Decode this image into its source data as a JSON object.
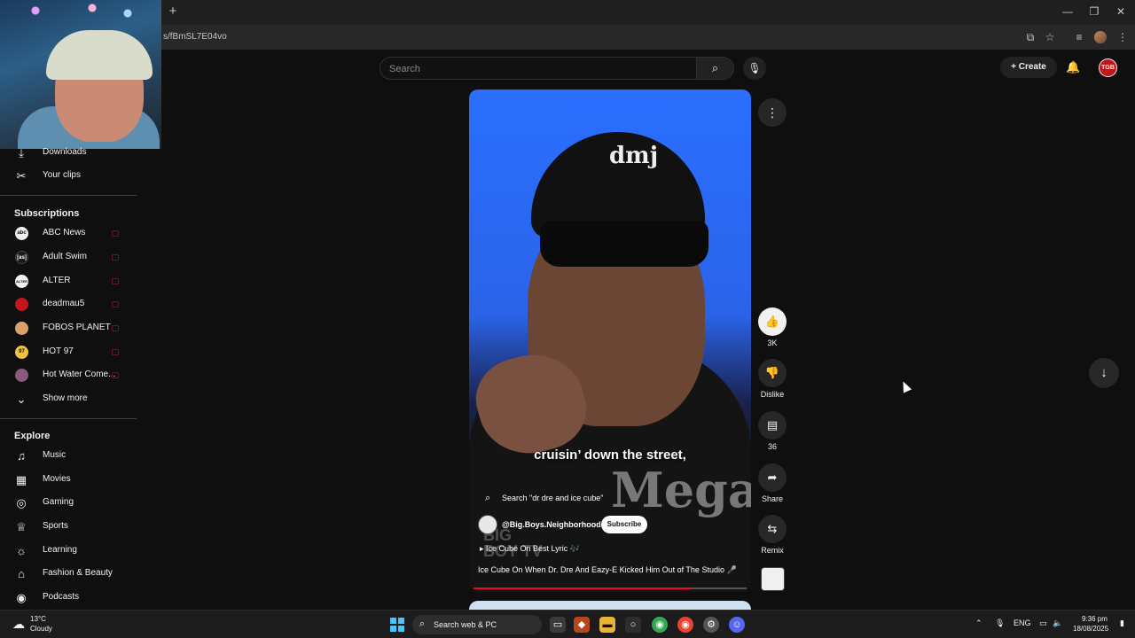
{
  "browser": {
    "url": "s/fBmSL7E04vo",
    "new_tab_icon": "+",
    "minimize_icon": "—",
    "restore_icon": "❐",
    "close_icon": "✕"
  },
  "header": {
    "search_placeholder": "Search",
    "create_label": "Create",
    "avatar_text": "TGB"
  },
  "sidebar": {
    "top_items": [
      {
        "label": "Downloads",
        "icon": "download-icon"
      },
      {
        "label": "Your clips",
        "icon": "scissors-icon"
      }
    ],
    "subscriptions_title": "Subscriptions",
    "subscriptions": [
      {
        "label": "ABC News",
        "color": "#f1f1f1",
        "text": "abc"
      },
      {
        "label": "Adult Swim",
        "color": "#1a1a1a",
        "text": "[as]"
      },
      {
        "label": "ALTER",
        "color": "#f1f1f1",
        "text": "ALTER"
      },
      {
        "label": "deadmau5",
        "color": "#c4151c",
        "text": ""
      },
      {
        "label": "FOBOS PLANET",
        "color": "#d9a26a",
        "text": ""
      },
      {
        "label": "HOT 97",
        "color": "#f0c040",
        "text": "97"
      },
      {
        "label": "Hot Water Come...",
        "color": "#8a5a7a",
        "text": ""
      }
    ],
    "show_more": "Show more",
    "explore_title": "Explore",
    "explore": [
      {
        "label": "Music",
        "icon": "music-note-icon"
      },
      {
        "label": "Movies",
        "icon": "film-icon"
      },
      {
        "label": "Gaming",
        "icon": "gamepad-icon"
      },
      {
        "label": "Sports",
        "icon": "trophy-icon"
      },
      {
        "label": "Learning",
        "icon": "lightbulb-icon"
      },
      {
        "label": "Fashion & Beauty",
        "icon": "hanger-icon"
      },
      {
        "label": "Podcasts",
        "icon": "podcast-icon"
      }
    ]
  },
  "video": {
    "cap_logo": "dmj",
    "caption": "cruisin’ down the street,",
    "watermark": "Mega",
    "brand": "BIG\nBOY TV",
    "search_label": "Search \"dr dre and ice cube\"",
    "channel": "@Big.Boys.Neighborhood",
    "subscribe_label": "Subscribe",
    "sound_label": "▸  Ice Cube On Best Lyric 🎶",
    "title": "Ice Cube On When Dr. Dre And Eazy-E Kicked Him Out of The Studio 🎤",
    "progress": 0.8
  },
  "actions": {
    "like_count": "3K",
    "dislike_label": "Dislike",
    "comment_count": "36",
    "share_label": "Share",
    "remix_label": "Remix"
  },
  "taskbar": {
    "weather_temp": "13°C",
    "weather_condition": "Cloudy",
    "search_label": "Search web & PC",
    "language": "ENG",
    "time": "9:36 pm",
    "date": "18/08/2025"
  }
}
